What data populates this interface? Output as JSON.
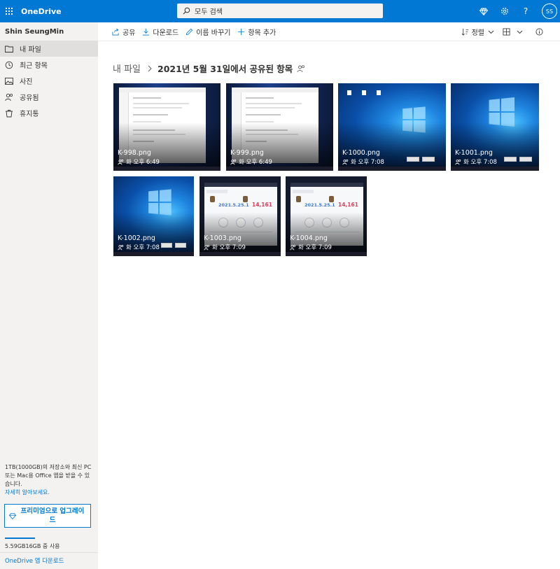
{
  "app": {
    "title": "OneDrive",
    "search_placeholder": "모두 검색",
    "avatar_initials": "SS",
    "accent_color": "#0078d4"
  },
  "topbar": {
    "icons": [
      "waffle-icon",
      "diamond-icon",
      "gear-icon",
      "help-icon"
    ]
  },
  "sidebar": {
    "user_name": "Shin SeungMin",
    "items": [
      {
        "label": "내 파일",
        "icon": "folder-icon",
        "active": true
      },
      {
        "label": "최근 항목",
        "icon": "recent-icon",
        "active": false
      },
      {
        "label": "사진",
        "icon": "photo-icon",
        "active": false
      },
      {
        "label": "공유됨",
        "icon": "shared-icon",
        "active": false
      },
      {
        "label": "휴지통",
        "icon": "recycle-bin-icon",
        "active": false
      }
    ],
    "storage_text": "1TB(1000GB)의 저장소와 최신 PC 또는 Mac용 Office 앱을 받을 수 있습니다.",
    "learn_more": "자세히 알아보세요.",
    "upgrade_label": "프리미엄으로 업그레이드",
    "usage_text": "5.59GB16GB 중 사용",
    "usage_fraction": 0.35,
    "app_download": "OneDrive 앱 다운로드"
  },
  "commands": {
    "share": "공유",
    "download": "다운로드",
    "rename": "이름 바꾸기",
    "add": "항목 추가",
    "sort": "정렬"
  },
  "breadcrumb": {
    "root": "내 파일",
    "current": "2021년 5월 31일에서 공유된 항목"
  },
  "files": [
    {
      "name": "K-998.png",
      "meta": "화 오후 6:49",
      "thumb": "document-window"
    },
    {
      "name": "K-999.png",
      "meta": "화 오후 6:49",
      "thumb": "document-window"
    },
    {
      "name": "K-1000.png",
      "meta": "화 오후 7:08",
      "thumb": "windows-desktop"
    },
    {
      "name": "K-1001.png",
      "meta": "화 오후 7:08",
      "thumb": "windows-desktop"
    },
    {
      "name": "K-1002.png",
      "meta": "화 오후 7:08",
      "thumb": "windows-desktop"
    },
    {
      "name": "K-1003.png",
      "meta": "화 오후 7:09",
      "thumb": "app-window",
      "date_text": "2021.5.25.1",
      "number_text": "14,161"
    },
    {
      "name": "K-1004.png",
      "meta": "화 오후 7:09",
      "thumb": "app-window",
      "date_text": "2021.5.25.1",
      "number_text": "14,161"
    }
  ]
}
